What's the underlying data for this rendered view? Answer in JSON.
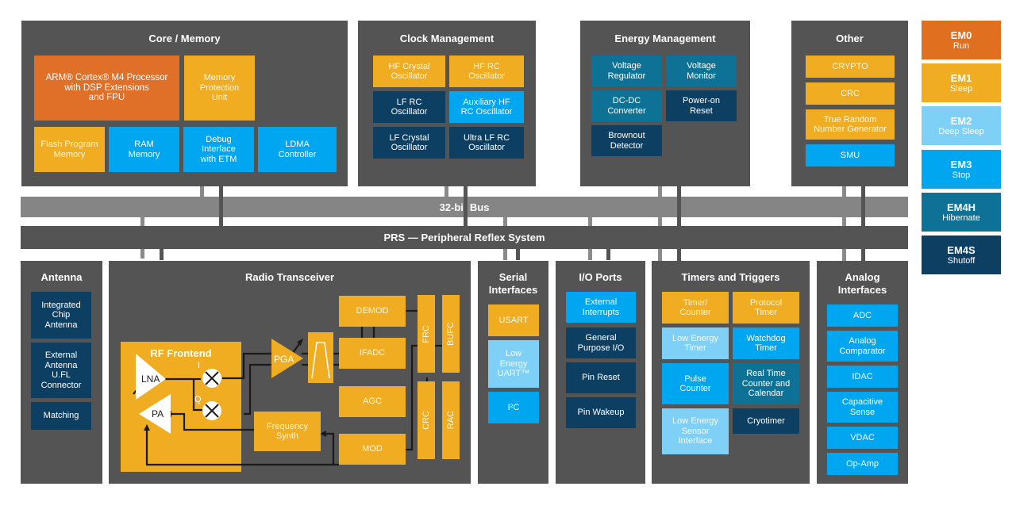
{
  "groups": {
    "core": {
      "title": "Core / Memory",
      "blocks": [
        "ARM® Cortex® M4 Processor\nwith DSP Extensions\nand FPU",
        "Memory\nProtection\nUnit",
        "Flash Program\nMemory",
        "RAM\nMemory",
        "Debug\nInterface\nwith ETM",
        "LDMA\nController"
      ]
    },
    "clock": {
      "title": "Clock Management",
      "blocks": [
        "HF Crystal\nOscillator",
        "HF RC\nOscillator",
        "LF RC\nOscillator",
        "Auxiliary HF\nRC Oscillator",
        "LF Crystal\nOscillator",
        "Ultra LF RC\nOscillator"
      ]
    },
    "energy": {
      "title": "Energy Management",
      "blocks": [
        "Voltage\nRegulator",
        "Voltage\nMonitor",
        "DC-DC\nConverter",
        "Power-on\nReset",
        "Brownout\nDetector"
      ]
    },
    "other": {
      "title": "Other",
      "blocks": [
        "CRYPTO",
        "CRC",
        "True Random\nNumber Generator",
        "SMU"
      ]
    },
    "antenna": {
      "title": "Antenna",
      "blocks": [
        "Integrated\nChip\nAntenna",
        "External\nAntenna\nU.FL\nConnector",
        "Matching"
      ]
    },
    "radio": {
      "title": "Radio Transceiver",
      "rf_frontend": {
        "title": "RF Frontend",
        "lna": "LNA",
        "pa": "PA",
        "i_label": "I",
        "q_label": "Q"
      },
      "pga": "PGA",
      "blocks": [
        "DEMOD",
        "IFADC",
        "AGC",
        "Frequency\nSynth",
        "MOD"
      ],
      "vertical_blocks": [
        "FRC",
        "BUFC",
        "CRC",
        "RAC"
      ]
    },
    "serial": {
      "title": "Serial\nInterfaces",
      "blocks": [
        "USART",
        "Low\nEnergy\nUART™",
        "I²C"
      ]
    },
    "io": {
      "title": "I/O Ports",
      "blocks": [
        "External\nInterrupts",
        "General\nPurpose I/O",
        "Pin Reset",
        "Pin Wakeup"
      ]
    },
    "timers": {
      "title": "Timers and Triggers",
      "blocks": [
        "Timer/\nCounter",
        "Protocol\nTimer",
        "Low Energy\nTimer",
        "Watchdog\nTimer",
        "Pulse\nCounter",
        "Real Time\nCounter and\nCalendar",
        "Low Energy\nSensor\nInterface",
        "Cryotimer"
      ]
    },
    "analog": {
      "title": "Analog\nInterfaces",
      "blocks": [
        "ADC",
        "Analog\nComparator",
        "IDAC",
        "Capacitive\nSense",
        "VDAC",
        "Op-Amp"
      ]
    }
  },
  "buses": {
    "bus32": "32-bit Bus",
    "prs": "PRS — Peripheral Reflex System"
  },
  "legend": [
    {
      "mode": "EM0",
      "state": "Run",
      "color": "#e06f1f"
    },
    {
      "mode": "EM1",
      "state": "Sleep",
      "color": "#f0ad22"
    },
    {
      "mode": "EM2",
      "state": "Deep Sleep",
      "color": "#7fd0f7"
    },
    {
      "mode": "EM3",
      "state": "Stop",
      "color": "#00a6f0"
    },
    {
      "mode": "EM4H",
      "state": "Hibernate",
      "color": "#0d7296"
    },
    {
      "mode": "EM4S",
      "state": "Shutoff",
      "color": "#0d3f63"
    }
  ],
  "colors": {
    "group_bg": "#545454",
    "bus32": "#858585",
    "prs": "#545454",
    "rf_orange": "#f0ad22"
  }
}
